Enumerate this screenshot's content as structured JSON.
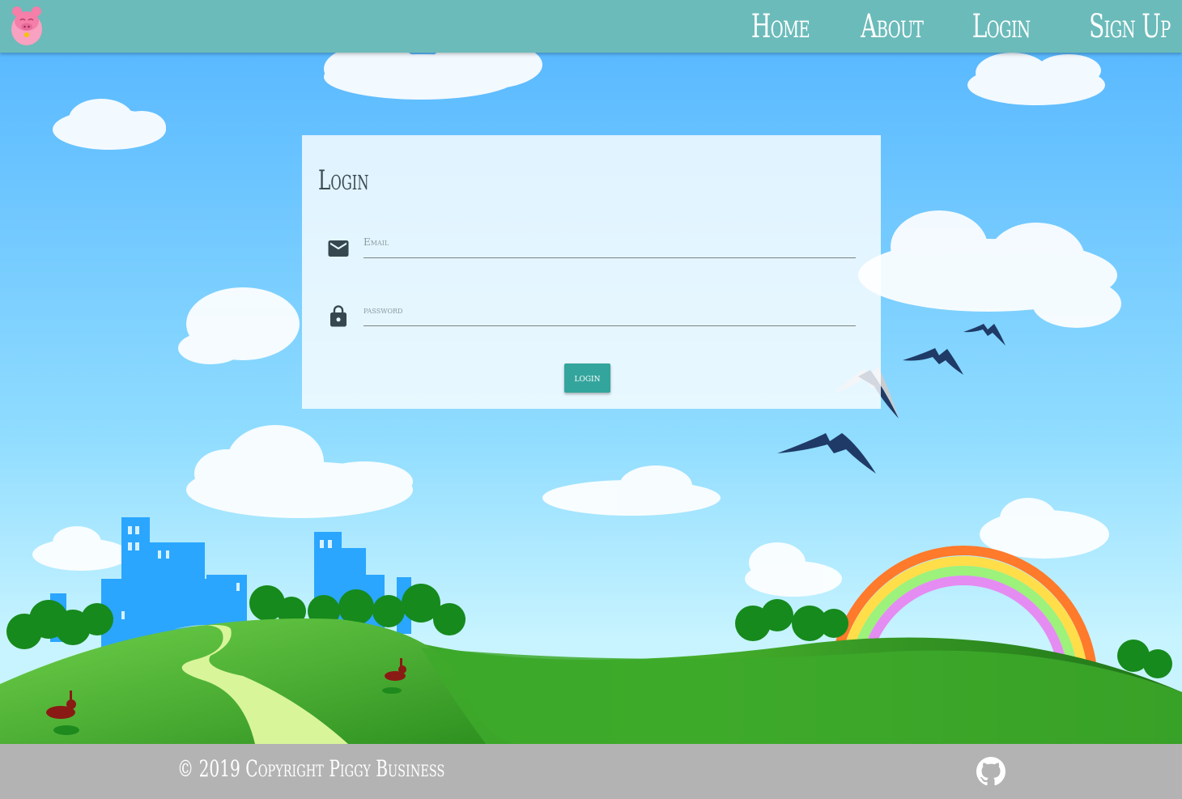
{
  "navbar": {
    "links": [
      {
        "label": "Home"
      },
      {
        "label": "About"
      },
      {
        "label": "Login"
      },
      {
        "label": "Sign Up"
      }
    ],
    "logo_icon": "pig-logo-icon"
  },
  "login_form": {
    "title": "Login",
    "email": {
      "placeholder": "Email",
      "value": "",
      "icon": "mail-icon"
    },
    "password": {
      "placeholder": "password",
      "value": "",
      "icon": "lock-icon"
    },
    "submit_label": "login"
  },
  "footer": {
    "copyright": "© 2019 Copyright Piggy Business",
    "github_icon": "github-icon"
  },
  "colors": {
    "navbar": "#6bbbba",
    "button": "#33a59c",
    "footer": "#b3b3b3",
    "sky_top": "#5ab9ff",
    "grass": "#3fa52a"
  }
}
